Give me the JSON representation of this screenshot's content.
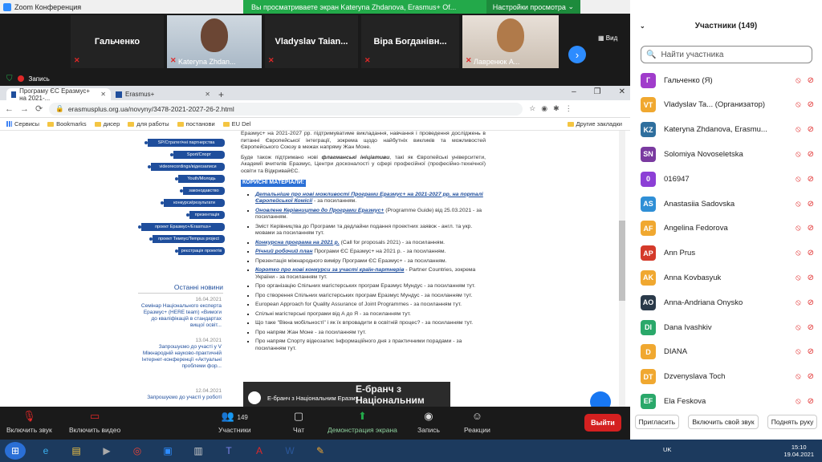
{
  "zoom": {
    "title": "Zoom Конференция",
    "share_banner": "Вы просматриваете экран Kateryna Zhdanova, Erasmus+ Of...",
    "view_options": "Настройки просмотра",
    "view_label": "Вид",
    "recording_label": "Запись"
  },
  "video_tiles": [
    {
      "name": "Гальченко"
    },
    {
      "name": "Kateryna Zhdan..."
    },
    {
      "name": "Vladyslav Taian..."
    },
    {
      "name": "Віра Богданівн..."
    },
    {
      "name": "Лавренюк А..."
    }
  ],
  "browser": {
    "tabs": [
      {
        "label": "Програму ЄС Еразмус+ на 2021-..."
      },
      {
        "label": "Erasmus+"
      }
    ],
    "url": "erasmusplus.org.ua/novyny/3478-2021-2027-26-2.html",
    "bookmarks": [
      "Сервисы",
      "Bookmarks",
      "дисер",
      "для работы",
      "постанови",
      "EU Del"
    ],
    "other_bookmarks": "Другие закладки"
  },
  "site": {
    "nav_pills": [
      "SP/Стратегічні партнерства",
      "Sport/Спорт",
      "videorecordings/відеозаписи",
      "Youth/Молодь",
      "законодавство",
      "конкурси/результати",
      "презентація",
      "проект Еразмус+/Erasmus+",
      "проект Темпус/Tempus project",
      "реєстрація проектів"
    ],
    "news_heading": "Останні новини",
    "news": [
      {
        "date": "16.04.2021",
        "text": "Семінар Національного експерта Еразмус+ (HERE team) «Вимоги до кваліфікацій в стандартах вищої освіт..."
      },
      {
        "date": "13.04.2021",
        "text": "Запрошуємо до участі у V Міжнародній науково-практичній Інтернет-конференції «Актуальні проблеми фор..."
      },
      {
        "date": "12.04.2021",
        "text": "Запрошуємо до участі у роботі"
      }
    ],
    "para1": "Еразмус+ на 2021-2027 pp. підтримуватиме викладання, навчання і проведення досліджень в питанні Європейської інтеграції, зокрема щодо найбутніх викликів та можливостей Європейського Союзу в межах напряму Жан Моне.",
    "para2_pre": "Буде також підтримано нові ",
    "para2_em": "флагманські ініціативи",
    "para2_post": ", такі як Європейські університети, Академії вчителів Еразмус, Центри досконалості у сфері професійної (професійно-технічної) освіти та ВідкривайЄС.",
    "useful_heading": "КОРИСНІ МАТЕРІАЛИ:",
    "materials": [
      {
        "link": "Детальніше про нові можливості Програми Еразмус+ на 2021-2027 рр. на порталі Європейської Комісії",
        "tail": " - за посиланням."
      },
      {
        "link": "Оновлене Керівництво до Програми Еразмус+",
        "tail": " (Programme Guide) від 25.03.2021 - за посиланням."
      },
      {
        "link": "",
        "tail": "Зміст Керівництва до Програми та дедлайни подання проектних заявок - англ. та укр. мовами за посиланням тут."
      },
      {
        "link": "Конкурсна програма на 2021 р.",
        "tail": " (Call for proposals 2021) - за посиланням."
      },
      {
        "link": "Річний робочий план",
        "tail": " Програми ЄС Еразмус+ на 2021 р. - за посиланням."
      },
      {
        "link": "",
        "tail": "Презентація міжнародного виміру Програми ЄС Еразмус+ - за посиланням."
      },
      {
        "link": "Коротко про нові конкурси за участі країн-партнерів",
        "tail": " - Partner Countries, зокрема України - за посиланням тут."
      },
      {
        "link": "",
        "tail": "Про організацію Спільних магістерських програм Еразмус Мундус - за посиланням тут."
      },
      {
        "link": "",
        "tail": "Про створення Спільних магістерських програм Еразмус Мундус - за посиланням тут."
      },
      {
        "link": "",
        "tail": "European Approach for Quality Assurance of Joint Programmes - за посиланням тут."
      },
      {
        "link": "",
        "tail": "Спільні магістерські програми від А до Я - за посиланням тут."
      },
      {
        "link": "",
        "tail": "Що таке \"Вікна мобільності\" і як їх впровадити в освітній процес? - за посиланням тут."
      },
      {
        "link": "",
        "tail": "Про напрям Жан Моне - за посиланням тут."
      },
      {
        "link": "",
        "tail": "Про напрям Спорту відеозапис Інформаційного дня з практичними порадами - за посиланням тут."
      }
    ],
    "video_title": "Е-бранч з Національним Еразму...",
    "video_big": "Е-бранч з Національним"
  },
  "participants": {
    "heading": "Участники (149)",
    "search_placeholder": "Найти участника",
    "list": [
      {
        "initials": "Г",
        "name": "Гальченко (Я)",
        "color": "#a03ccb"
      },
      {
        "initials": "VT",
        "name": "Vladyslav Ta... (Организатор)",
        "color": "#f0a830"
      },
      {
        "initials": "KZ",
        "name": "Kateryna Zhdanova, Erasmu...",
        "color": "#2f6f9e"
      },
      {
        "initials": "SN",
        "name": "Solomiya Novoseletska",
        "color": "#7a3aa0"
      },
      {
        "initials": "0",
        "name": "016947",
        "color": "#8c3fd6"
      },
      {
        "initials": "AS",
        "name": "Anastasiia Sadovska",
        "color": "#2f8fd6"
      },
      {
        "initials": "AF",
        "name": "Angelina Fedorova",
        "color": "#f0a830"
      },
      {
        "initials": "AP",
        "name": "Ann Prus",
        "color": "#d43a2a"
      },
      {
        "initials": "AK",
        "name": "Anna Kovbasyuk",
        "color": "#f0a830"
      },
      {
        "initials": "AO",
        "name": "Anna-Andriana Onysko",
        "color": "#2a3a4a"
      },
      {
        "initials": "DI",
        "name": "Dana Ivashkiv",
        "color": "#2aa86a"
      },
      {
        "initials": "D",
        "name": "DIANA",
        "color": "#f0a830"
      },
      {
        "initials": "DT",
        "name": "Dzvenyslava Toch",
        "color": "#f0a830"
      },
      {
        "initials": "EF",
        "name": "Ela Feskova",
        "color": "#2aa86a"
      }
    ],
    "invite": "Пригласить",
    "unmute_me": "Включить свой звук",
    "raise_hand": "Поднять руку"
  },
  "toolbar": {
    "audio": "Включить звук",
    "video": "Включить видео",
    "participants": "Участники",
    "participants_count": "149",
    "chat": "Чат",
    "share": "Демонстрация экрана",
    "record": "Запись",
    "reactions": "Реакции",
    "leave": "Выйти"
  },
  "taskbar": {
    "lang": "UK",
    "time": "15:10",
    "date": "19.04.2021"
  }
}
